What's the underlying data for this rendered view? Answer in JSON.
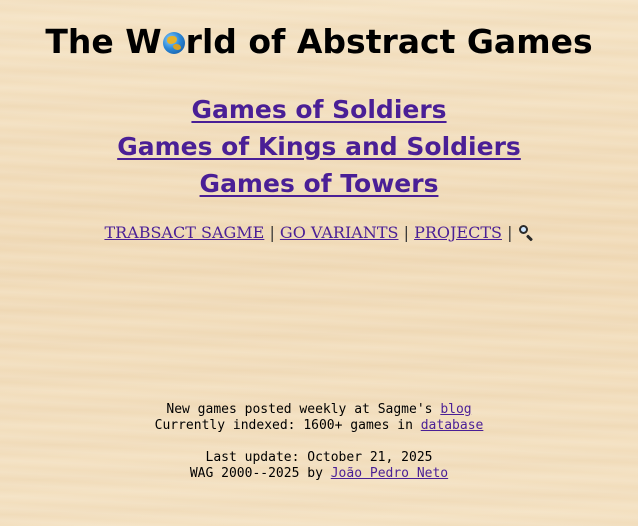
{
  "header": {
    "title_before": "The W",
    "title_after": "rld of Abstract Games",
    "globe_icon": "globe-icon"
  },
  "games": [
    {
      "label": "Games of Soldiers"
    },
    {
      "label": "Games of Kings and Soldiers"
    },
    {
      "label": "Games of Towers"
    }
  ],
  "nav": {
    "items": [
      {
        "label": "TRABSACT SAGME"
      },
      {
        "label": "GO VARIANTS"
      },
      {
        "label": "PROJECTS"
      }
    ],
    "separator": "|",
    "search_icon": "magnifier-icon"
  },
  "footer": {
    "line1_text": "New games posted weekly at Sagme's ",
    "line1_link": "blog",
    "line2_text": "Currently indexed: 1600+ games in ",
    "line2_link": "database",
    "line3_text": "Last update: October 21, 2025",
    "line4_text": "WAG 2000--2025 by ",
    "line4_link": "João Pedro Neto"
  },
  "colors": {
    "link": "#4a1f96",
    "background": "#f3dfbd",
    "text": "#000000"
  }
}
